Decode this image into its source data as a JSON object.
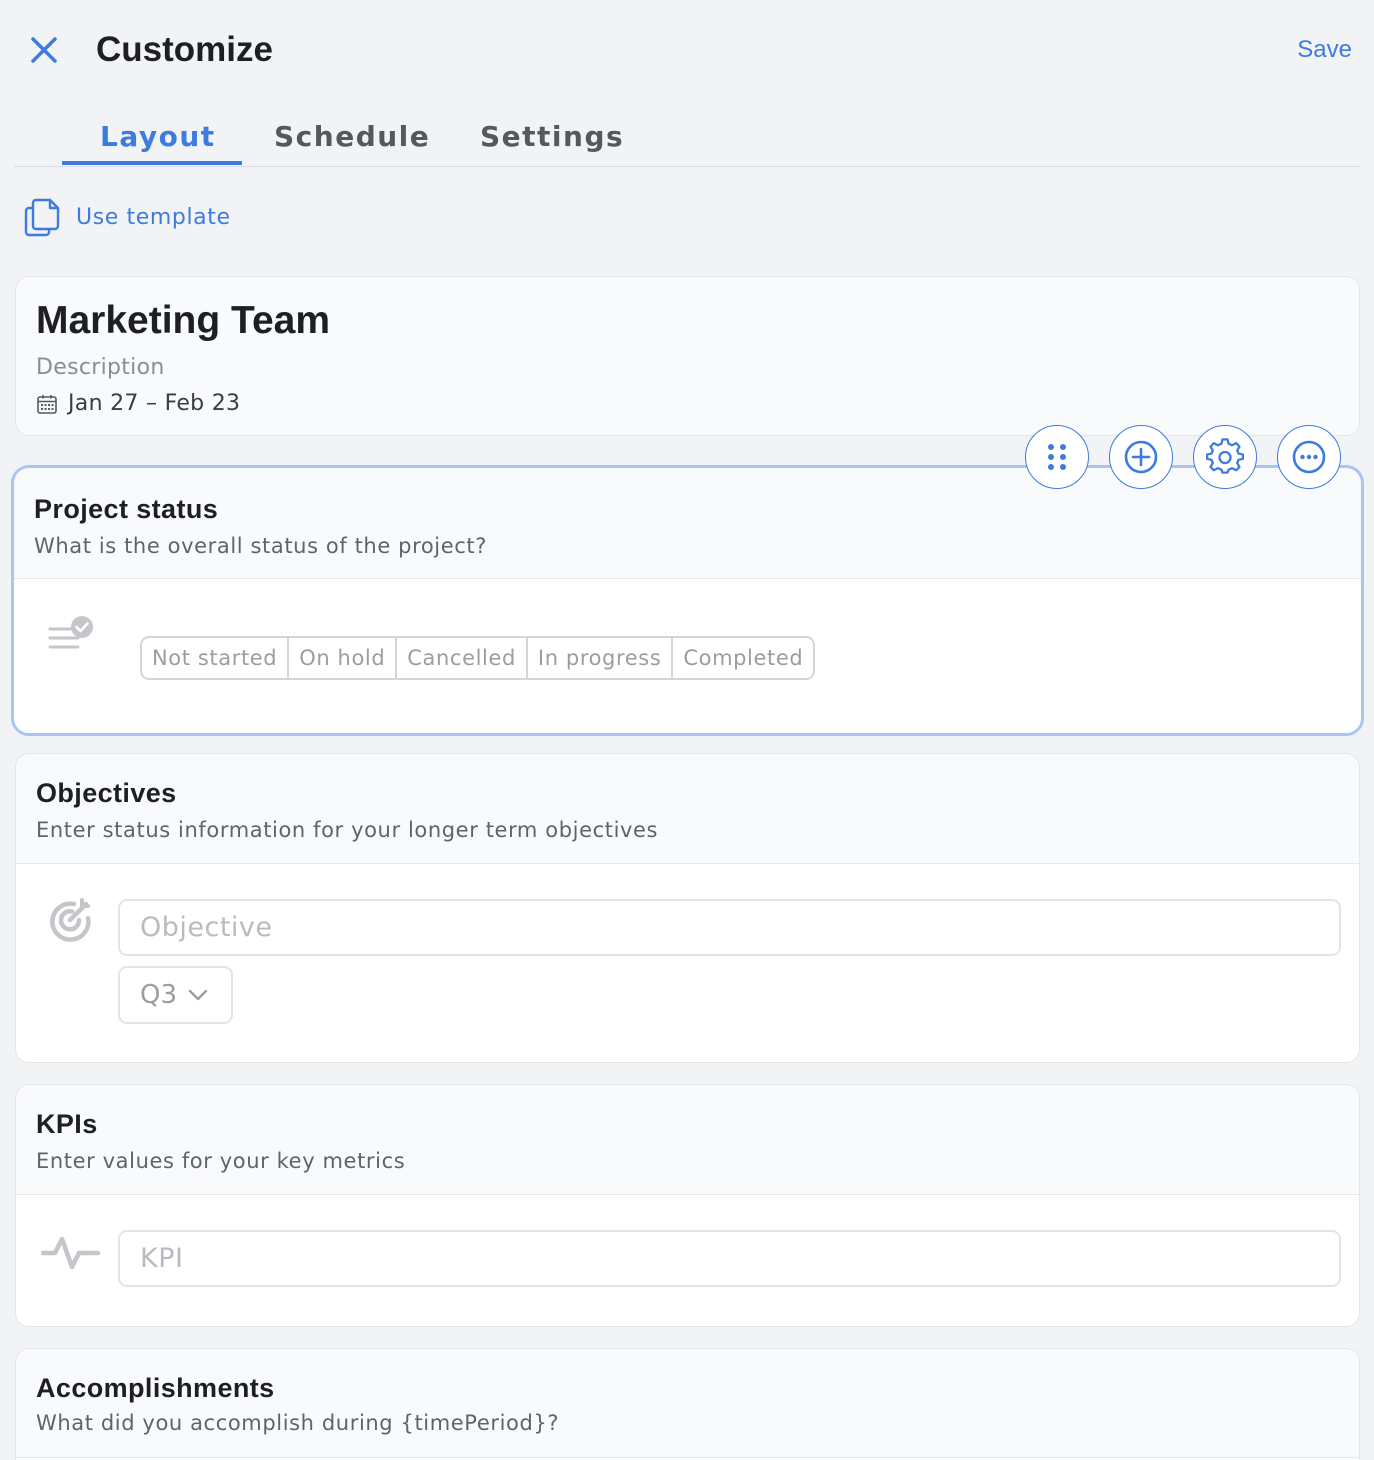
{
  "header": {
    "title": "Customize",
    "save_label": "Save",
    "close_icon": "close-icon"
  },
  "tabs": [
    {
      "label": "Layout",
      "active": true
    },
    {
      "label": "Schedule",
      "active": false
    },
    {
      "label": "Settings",
      "active": false
    }
  ],
  "use_template": {
    "label": "Use template",
    "icon": "copy-document-icon"
  },
  "team": {
    "name": "Marketing Team",
    "description": "Description",
    "dates": "Jan 27 – Feb 23",
    "dates_icon": "calendar-icon"
  },
  "toolbar": {
    "icons": [
      "drag-handle-icon",
      "add-circle-icon",
      "gear-icon",
      "more-icon"
    ]
  },
  "project_status": {
    "title": "Project status",
    "subtitle": "What is the overall status of the project?",
    "icon": "status-list-icon",
    "options": [
      "Not started",
      "On hold",
      "Cancelled",
      "In progress",
      "Completed"
    ]
  },
  "objectives": {
    "title": "Objectives",
    "subtitle": "Enter status information for your longer term objectives",
    "icon": "target-icon",
    "input_placeholder": "Objective",
    "input_value": "",
    "quarter": "Q3"
  },
  "kpis": {
    "title": "KPIs",
    "subtitle": "Enter values for your key metrics",
    "icon": "pulse-icon",
    "input_placeholder": "KPI",
    "input_value": ""
  },
  "accomplishments": {
    "title": "Accomplishments",
    "subtitle": "What did you accomplish during {timePeriod}?"
  },
  "colors": {
    "accent": "#3d7be0",
    "background": "#f2f3f5",
    "selected_border": "#a9c6f2"
  }
}
